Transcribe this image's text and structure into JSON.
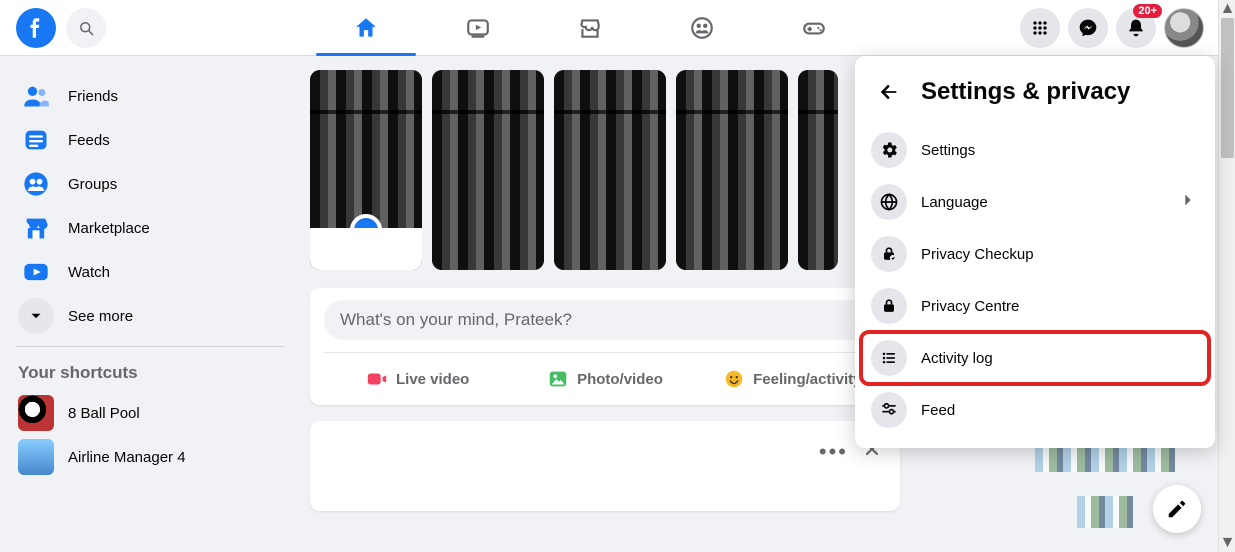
{
  "topnav": {
    "tabs": [
      "home",
      "watch",
      "marketplace",
      "groups",
      "gaming"
    ]
  },
  "notifications": {
    "badge": "20+"
  },
  "sidebar": {
    "items": [
      {
        "label": "Friends"
      },
      {
        "label": "Feeds"
      },
      {
        "label": "Groups"
      },
      {
        "label": "Marketplace"
      },
      {
        "label": "Watch"
      },
      {
        "label": "See more"
      }
    ],
    "shortcuts_header": "Your shortcuts",
    "shortcuts": [
      {
        "label": "8 Ball Pool"
      },
      {
        "label": "Airline Manager 4"
      }
    ]
  },
  "composer": {
    "placeholder": "What's on your mind, Prateek?",
    "buttons": {
      "live": "Live video",
      "photo": "Photo/video",
      "feeling": "Feeling/activity"
    }
  },
  "dropdown": {
    "title": "Settings & privacy",
    "items": [
      {
        "label": "Settings"
      },
      {
        "label": "Language",
        "chevron": true
      },
      {
        "label": "Privacy Checkup"
      },
      {
        "label": "Privacy Centre"
      },
      {
        "label": "Activity log",
        "highlight": true
      },
      {
        "label": "Feed"
      }
    ]
  }
}
